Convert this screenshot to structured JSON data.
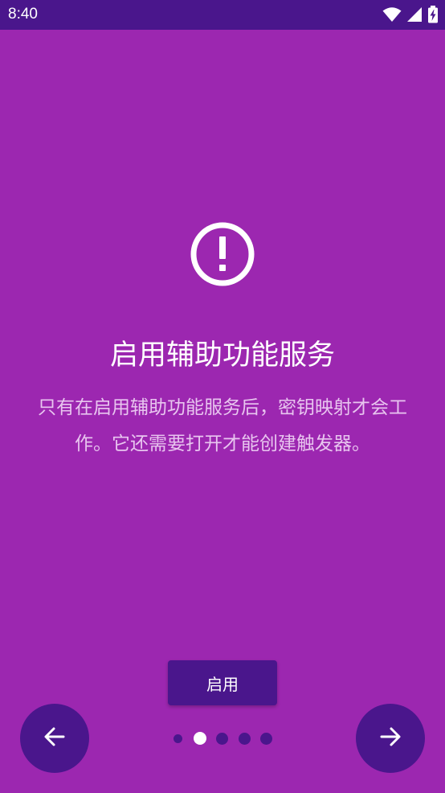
{
  "status_bar": {
    "time": "8:40",
    "icons": [
      "wifi-icon",
      "signal-icon",
      "battery-icon"
    ]
  },
  "page": {
    "icon": "alert-circle-icon",
    "title": "启用辅助功能服务",
    "description_lines": [
      "只有在启用辅助功能服务后，密钥映射才会工",
      "作。它还需要打开才能创建触发器。"
    ]
  },
  "actions": {
    "enable_label": "启用",
    "prev_icon": "arrow-left-icon",
    "next_icon": "arrow-right-icon"
  },
  "pagination": {
    "total": 5,
    "current": 2
  },
  "colors": {
    "background": "#9c27b0",
    "status_bar": "#4a168c",
    "accent": "#4a168c",
    "text": "#ffffff"
  }
}
